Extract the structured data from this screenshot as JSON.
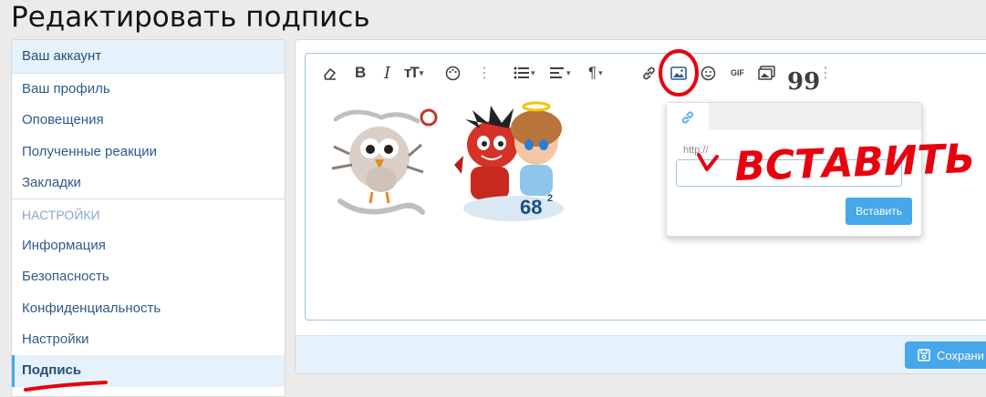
{
  "page": {
    "title": "Редактировать подпись"
  },
  "sidebar": {
    "header": "Ваш аккаунт",
    "items": [
      {
        "label": "Ваш профиль"
      },
      {
        "label": "Оповещения"
      },
      {
        "label": "Полученные реакции"
      },
      {
        "label": "Закладки"
      }
    ],
    "section": "НАСТРОЙКИ",
    "settings_items": [
      {
        "label": "Информация"
      },
      {
        "label": "Безопасность"
      },
      {
        "label": "Конфиденциальность"
      },
      {
        "label": "Настройки"
      },
      {
        "label": "Подпись",
        "active": true
      }
    ]
  },
  "toolbar": {
    "icons": [
      "eraser-icon",
      "bold-icon",
      "italic-icon",
      "text-size-icon",
      "palette-icon",
      "more-icon",
      "list-icon",
      "align-icon",
      "paragraph-icon",
      "link-icon",
      "image-icon",
      "smiley-icon",
      "gif-icon",
      "media-icon",
      "quote-icon",
      "more-icon"
    ],
    "gif_label": "GIF"
  },
  "signature_images": {
    "icons": [
      "owl-sticker-image",
      "devil-angel-sticker-image"
    ],
    "badge_text": "68"
  },
  "image_popup": {
    "url_label": "http://",
    "url_value": "",
    "insert_label": "Вставить"
  },
  "footer": {
    "save_label": "Сохрани"
  },
  "annotations": {
    "handwritten_text": "ВСТАВИТЬ",
    "color": "#e8000e"
  },
  "colors": {
    "accent": "#47a7eb",
    "link": "#2d5b8a",
    "header_bg": "#e5f1fb",
    "annotation": "#e8000e"
  }
}
